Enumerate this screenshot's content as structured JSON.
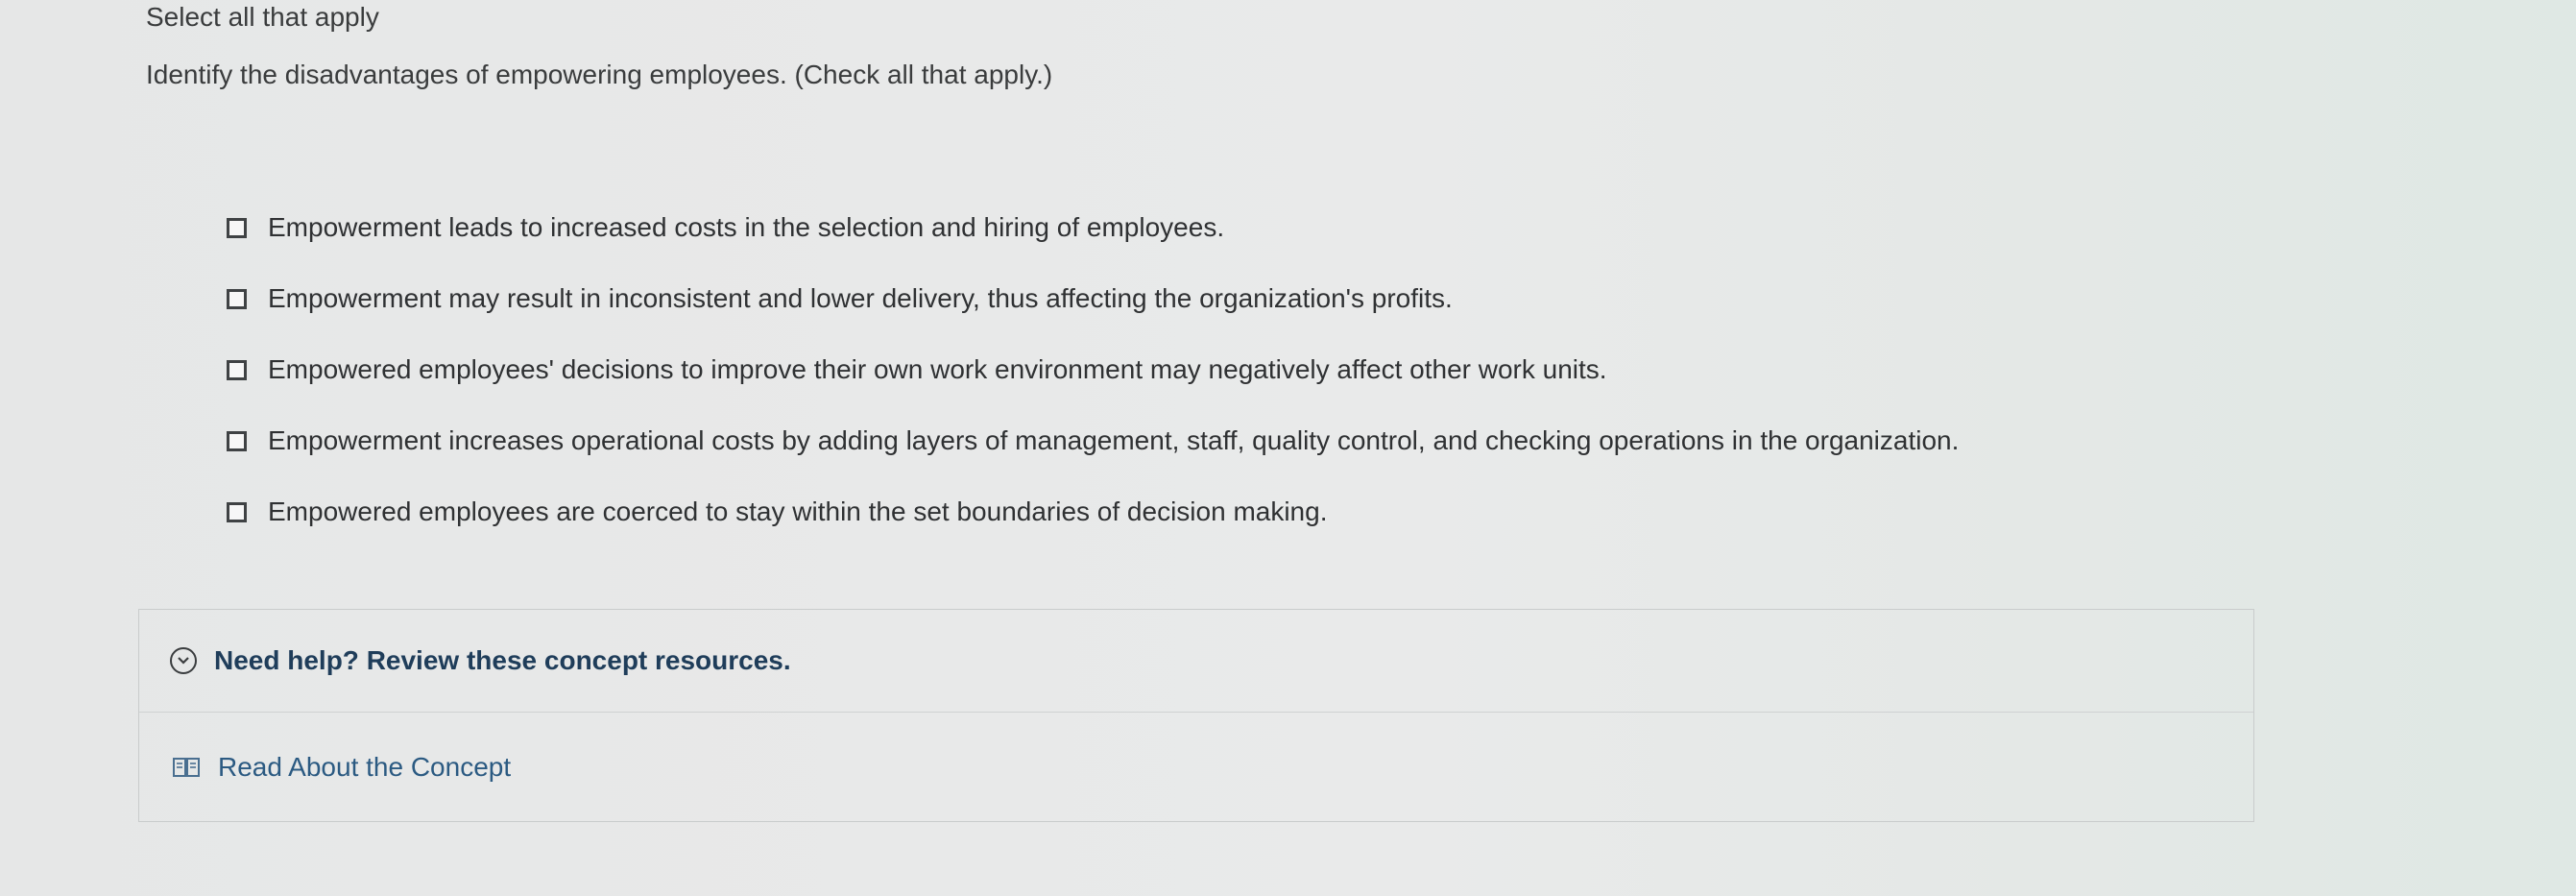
{
  "instruction": "Select all that apply",
  "question": "Identify the disadvantages of empowering employees. (Check all that apply.)",
  "options": [
    {
      "label": "Empowerment leads to increased costs in the selection and hiring of employees.",
      "checked": false
    },
    {
      "label": "Empowerment may result in inconsistent and lower delivery, thus affecting the organization's profits.",
      "checked": false
    },
    {
      "label": "Empowered employees' decisions to improve their own work environment may negatively affect other work units.",
      "checked": false
    },
    {
      "label": "Empowerment increases operational costs by adding layers of management, staff, quality control, and checking operations in the organization.",
      "checked": false
    },
    {
      "label": "Empowered employees are coerced to stay within the set boundaries of decision making.",
      "checked": false
    }
  ],
  "help": {
    "title": "Need help? Review these concept resources.",
    "icon": "chevron-down-circle-icon",
    "resources": [
      {
        "label": "Read About the Concept",
        "icon": "book-icon"
      }
    ]
  },
  "colors": {
    "link": "#2b5a82",
    "help_title": "#1f3d5a",
    "text": "#2f3133"
  }
}
